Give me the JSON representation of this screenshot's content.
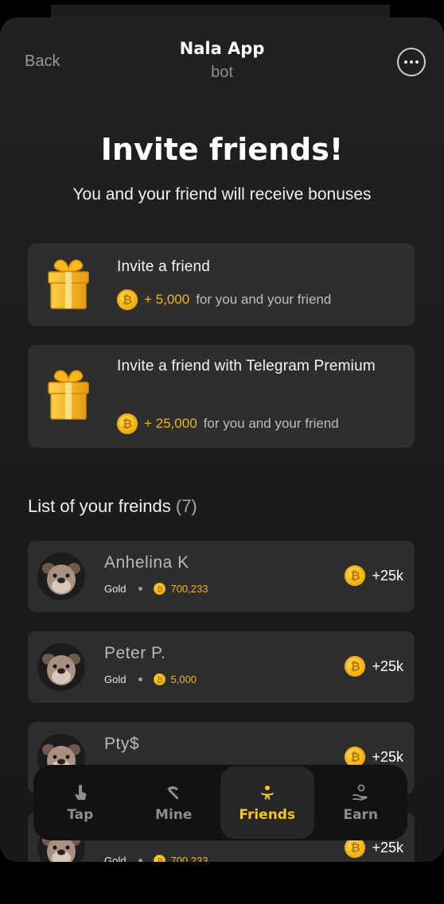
{
  "header": {
    "back_label": "Back",
    "title": "Nala App",
    "subtitle": "bot"
  },
  "hero": {
    "title": "Invite friends!",
    "subtitle": "You and your friend will receive bonuses"
  },
  "invites": [
    {
      "title": "Invite a friend",
      "amount": "+ 5,000",
      "note": "for you and your friend"
    },
    {
      "title": "Invite a friend with Telegram Premium",
      "amount": "+ 25,000",
      "note": "for you and your friend"
    }
  ],
  "friends_list": {
    "title": "List of your freinds",
    "count": "(7)",
    "items": [
      {
        "name": "Anhelina K",
        "level": "Gold",
        "balance": "700,233",
        "bonus": "+25k"
      },
      {
        "name": "Peter P.",
        "level": "Gold",
        "balance": "5,000",
        "bonus": "+25k"
      },
      {
        "name": "Pty$",
        "level": "",
        "balance": "",
        "bonus": "+25k"
      },
      {
        "name": "",
        "level": "Gold",
        "balance": "700,233",
        "bonus": "+25k"
      }
    ]
  },
  "tabbar": {
    "tabs": [
      {
        "label": "Tap",
        "icon": "tap-icon"
      },
      {
        "label": "Mine",
        "icon": "pickaxe-icon"
      },
      {
        "label": "Friends",
        "icon": "friends-icon",
        "active": true
      },
      {
        "label": "Earn",
        "icon": "earn-icon"
      }
    ]
  },
  "colors": {
    "accent": "#f3c623",
    "coin": "#f5b511",
    "card_bg": "#2e2e2e"
  }
}
